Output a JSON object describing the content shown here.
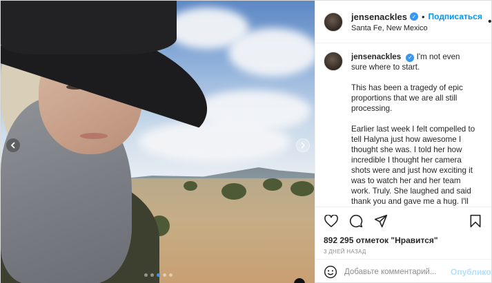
{
  "post": {
    "author": {
      "username": "jensenackles",
      "verified": true,
      "follow_label": "Подписаться",
      "separator": "•",
      "location": "Santa Fe, New Mexico",
      "more_icon": "more-horizontal-icon"
    },
    "caption": {
      "username": "jensenackles",
      "paragraphs": [
        "I'm not even sure where to start.",
        "This has been a tragedy of epic proportions that we are all still processing.",
        "Earlier last week I felt compelled to tell Halyna just how awesome I thought she was. I told her how incredible I thought her camera shots were and just how exciting it was to watch her and her team work. Truly. She laughed and said thank you and gave me a hug. I'll forever be thankful we had that moment.  She had a spunk and passion that infected the"
      ]
    },
    "actions": {
      "like_icon": "heart-icon",
      "comment_icon": "comment-icon",
      "share_icon": "share-icon",
      "save_icon": "bookmark-icon"
    },
    "likes_text": "892 295 отметок \"Нравится\"",
    "time_text": "3 ДНЕЙ НАЗАД",
    "comment": {
      "emoji_icon": "emoji-icon",
      "placeholder": "Добавьте комментарий...",
      "publish_label": "Опубликовать"
    },
    "media": {
      "carousel_total": 5,
      "carousel_active": 2,
      "prev_icon": "chevron-left-icon",
      "next_icon": "chevron-right-icon"
    }
  }
}
